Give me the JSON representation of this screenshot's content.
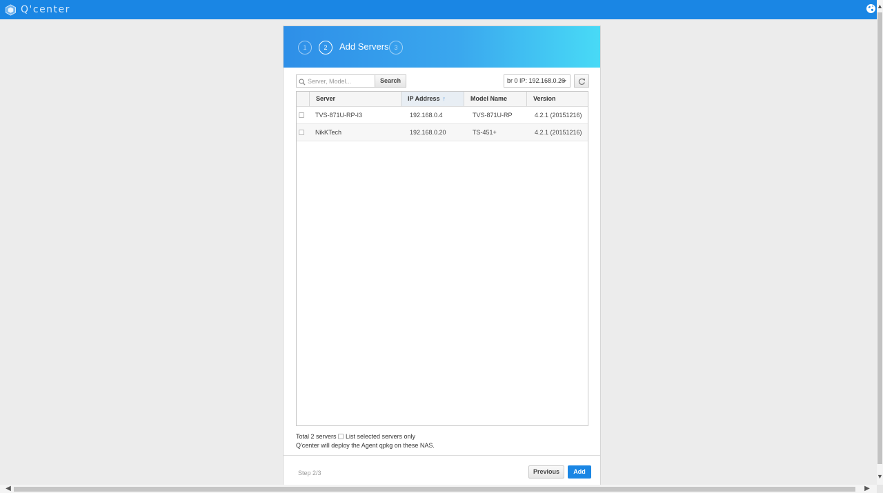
{
  "app": {
    "logo_text": "Q'center",
    "logo_icon": "qcenter-cube-icon",
    "language_icon": "globe-icon"
  },
  "wizard": {
    "title": "Add Servers",
    "steps": [
      "1",
      "2",
      "3"
    ],
    "active_step": 2,
    "search": {
      "placeholder": "Server, Model...",
      "value": "",
      "button_label": "Search"
    },
    "interface_select": {
      "value": "br 0 IP: 192.168.0.20"
    },
    "table": {
      "columns": [
        "Server",
        "IP Address",
        "Model Name",
        "Version"
      ],
      "sorted_column": "IP Address",
      "sort_direction": "ascending",
      "rows": [
        {
          "server": "TVS-871U-RP-I3",
          "ip": "192.168.0.4",
          "model": "TVS-871U-RP",
          "version": "4.2.1 (20151216)"
        },
        {
          "server": "NikKTech",
          "ip": "192.168.0.20",
          "model": "TS-451+",
          "version": "4.2.1 (20151216)"
        }
      ]
    },
    "total_label": "Total 2 servers",
    "list_selected_label": "List selected servers only",
    "deploy_note": "Q'center will deploy the Agent qpkg on these NAS.",
    "footer": {
      "step_label": "Step 2/3",
      "previous_label": "Previous",
      "add_label": "Add"
    }
  },
  "colors": {
    "topbar": "#1a86e4",
    "header_gradient_start": "#2e8fe8",
    "header_gradient_end": "#48daf6",
    "primary_button": "#1a86e4"
  }
}
